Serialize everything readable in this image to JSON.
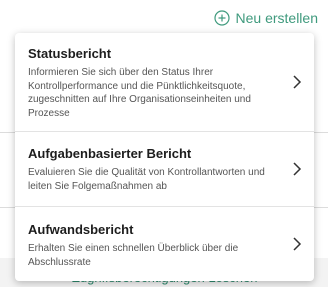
{
  "header": {
    "new_button_label": "Neu erstellen",
    "new_button_icon": "plus-circle-icon",
    "accent_color": "#3f9a7d"
  },
  "background": {
    "partial_link_text": "Zugriffsberechtigungen  Löschen"
  },
  "menu": {
    "items": [
      {
        "title": "Statusbericht",
        "description": "Informieren Sie sich über den Status Ihrer Kontrollperformance und die Pünktlichkeitsquote, zugeschnitten auf Ihre Organisationseinheiten und Prozesse",
        "icon": "chevron-right-icon"
      },
      {
        "title": "Aufgabenbasierter Bericht",
        "description": "Evaluieren Sie die Qualität von Kontrollantworten und leiten Sie Folgemaßnahmen ab",
        "icon": "chevron-right-icon"
      },
      {
        "title": "Aufwandsbericht",
        "description": "Erhalten Sie einen schnellen Überblick über die Abschlussrate",
        "icon": "chevron-right-icon"
      }
    ]
  }
}
